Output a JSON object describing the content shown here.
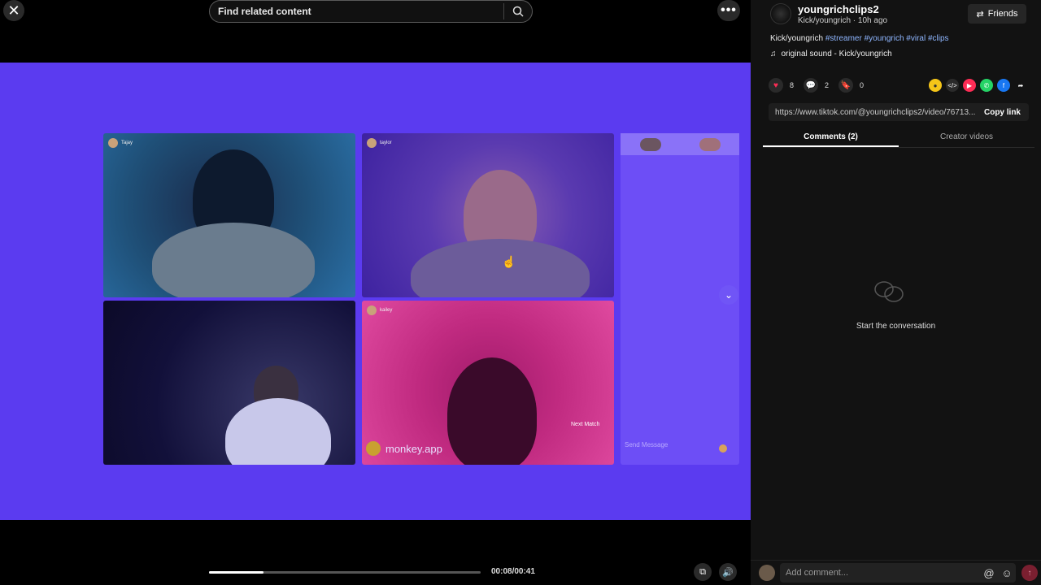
{
  "player": {
    "search_placeholder": "Find related content",
    "close_icon": "close-icon",
    "more_icon": "more-icon",
    "progress_fraction": 0.2,
    "time": "00:08/00:41",
    "overlay": {
      "tile_labels": [
        "Tajay",
        "taylor",
        "",
        "kailey"
      ],
      "watermark": "monkey.app",
      "next_match": "Next Match",
      "send_message": "Send Message"
    }
  },
  "author": {
    "username": "youngrichclips2",
    "subline": "Kick/youngrich · 10h ago",
    "friends_label": "Friends"
  },
  "post": {
    "desc_prefix": "Kick/youngrich",
    "hashtags": "#streamer #youngrich #viral #clips",
    "sound": "original sound - Kick/youngrich",
    "likes": "8",
    "comments": "2",
    "saves": "0",
    "url": "https://www.tiktok.com/@youngrichclips2/video/76713...",
    "copy_label": "Copy link"
  },
  "tabs": {
    "comments": "Comments (2)",
    "creator": "Creator videos"
  },
  "empty_state": "Start the conversation",
  "comment_box": {
    "placeholder": "Add comment..."
  },
  "colors": {
    "accent": "#fe2c55",
    "frame": "#5b3bf0"
  }
}
